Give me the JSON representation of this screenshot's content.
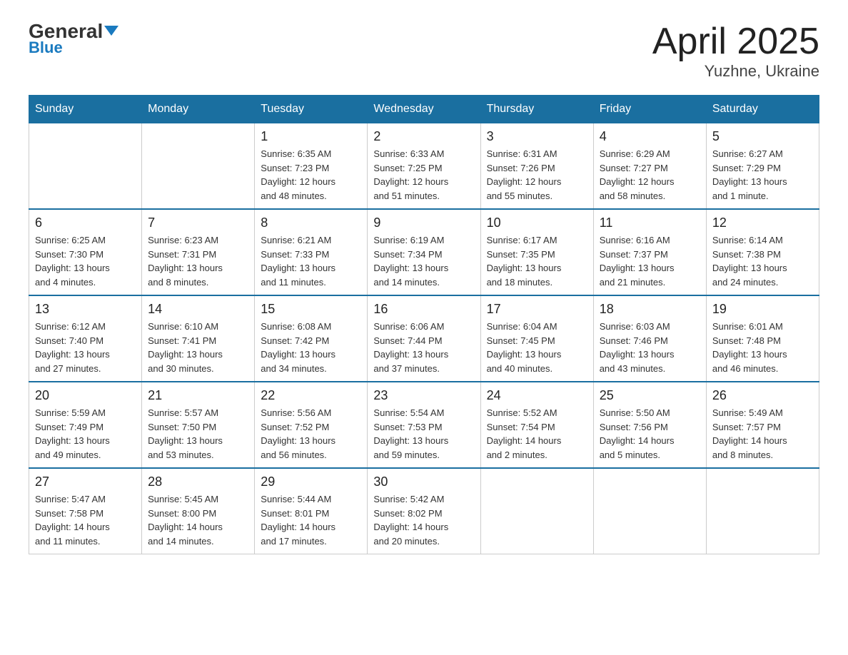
{
  "header": {
    "logo_main": "General",
    "logo_sub": "Blue",
    "title": "April 2025",
    "subtitle": "Yuzhne, Ukraine"
  },
  "days_of_week": [
    "Sunday",
    "Monday",
    "Tuesday",
    "Wednesday",
    "Thursday",
    "Friday",
    "Saturday"
  ],
  "weeks": [
    [
      {
        "day": "",
        "info": ""
      },
      {
        "day": "",
        "info": ""
      },
      {
        "day": "1",
        "info": "Sunrise: 6:35 AM\nSunset: 7:23 PM\nDaylight: 12 hours\nand 48 minutes."
      },
      {
        "day": "2",
        "info": "Sunrise: 6:33 AM\nSunset: 7:25 PM\nDaylight: 12 hours\nand 51 minutes."
      },
      {
        "day": "3",
        "info": "Sunrise: 6:31 AM\nSunset: 7:26 PM\nDaylight: 12 hours\nand 55 minutes."
      },
      {
        "day": "4",
        "info": "Sunrise: 6:29 AM\nSunset: 7:27 PM\nDaylight: 12 hours\nand 58 minutes."
      },
      {
        "day": "5",
        "info": "Sunrise: 6:27 AM\nSunset: 7:29 PM\nDaylight: 13 hours\nand 1 minute."
      }
    ],
    [
      {
        "day": "6",
        "info": "Sunrise: 6:25 AM\nSunset: 7:30 PM\nDaylight: 13 hours\nand 4 minutes."
      },
      {
        "day": "7",
        "info": "Sunrise: 6:23 AM\nSunset: 7:31 PM\nDaylight: 13 hours\nand 8 minutes."
      },
      {
        "day": "8",
        "info": "Sunrise: 6:21 AM\nSunset: 7:33 PM\nDaylight: 13 hours\nand 11 minutes."
      },
      {
        "day": "9",
        "info": "Sunrise: 6:19 AM\nSunset: 7:34 PM\nDaylight: 13 hours\nand 14 minutes."
      },
      {
        "day": "10",
        "info": "Sunrise: 6:17 AM\nSunset: 7:35 PM\nDaylight: 13 hours\nand 18 minutes."
      },
      {
        "day": "11",
        "info": "Sunrise: 6:16 AM\nSunset: 7:37 PM\nDaylight: 13 hours\nand 21 minutes."
      },
      {
        "day": "12",
        "info": "Sunrise: 6:14 AM\nSunset: 7:38 PM\nDaylight: 13 hours\nand 24 minutes."
      }
    ],
    [
      {
        "day": "13",
        "info": "Sunrise: 6:12 AM\nSunset: 7:40 PM\nDaylight: 13 hours\nand 27 minutes."
      },
      {
        "day": "14",
        "info": "Sunrise: 6:10 AM\nSunset: 7:41 PM\nDaylight: 13 hours\nand 30 minutes."
      },
      {
        "day": "15",
        "info": "Sunrise: 6:08 AM\nSunset: 7:42 PM\nDaylight: 13 hours\nand 34 minutes."
      },
      {
        "day": "16",
        "info": "Sunrise: 6:06 AM\nSunset: 7:44 PM\nDaylight: 13 hours\nand 37 minutes."
      },
      {
        "day": "17",
        "info": "Sunrise: 6:04 AM\nSunset: 7:45 PM\nDaylight: 13 hours\nand 40 minutes."
      },
      {
        "day": "18",
        "info": "Sunrise: 6:03 AM\nSunset: 7:46 PM\nDaylight: 13 hours\nand 43 minutes."
      },
      {
        "day": "19",
        "info": "Sunrise: 6:01 AM\nSunset: 7:48 PM\nDaylight: 13 hours\nand 46 minutes."
      }
    ],
    [
      {
        "day": "20",
        "info": "Sunrise: 5:59 AM\nSunset: 7:49 PM\nDaylight: 13 hours\nand 49 minutes."
      },
      {
        "day": "21",
        "info": "Sunrise: 5:57 AM\nSunset: 7:50 PM\nDaylight: 13 hours\nand 53 minutes."
      },
      {
        "day": "22",
        "info": "Sunrise: 5:56 AM\nSunset: 7:52 PM\nDaylight: 13 hours\nand 56 minutes."
      },
      {
        "day": "23",
        "info": "Sunrise: 5:54 AM\nSunset: 7:53 PM\nDaylight: 13 hours\nand 59 minutes."
      },
      {
        "day": "24",
        "info": "Sunrise: 5:52 AM\nSunset: 7:54 PM\nDaylight: 14 hours\nand 2 minutes."
      },
      {
        "day": "25",
        "info": "Sunrise: 5:50 AM\nSunset: 7:56 PM\nDaylight: 14 hours\nand 5 minutes."
      },
      {
        "day": "26",
        "info": "Sunrise: 5:49 AM\nSunset: 7:57 PM\nDaylight: 14 hours\nand 8 minutes."
      }
    ],
    [
      {
        "day": "27",
        "info": "Sunrise: 5:47 AM\nSunset: 7:58 PM\nDaylight: 14 hours\nand 11 minutes."
      },
      {
        "day": "28",
        "info": "Sunrise: 5:45 AM\nSunset: 8:00 PM\nDaylight: 14 hours\nand 14 minutes."
      },
      {
        "day": "29",
        "info": "Sunrise: 5:44 AM\nSunset: 8:01 PM\nDaylight: 14 hours\nand 17 minutes."
      },
      {
        "day": "30",
        "info": "Sunrise: 5:42 AM\nSunset: 8:02 PM\nDaylight: 14 hours\nand 20 minutes."
      },
      {
        "day": "",
        "info": ""
      },
      {
        "day": "",
        "info": ""
      },
      {
        "day": "",
        "info": ""
      }
    ]
  ]
}
